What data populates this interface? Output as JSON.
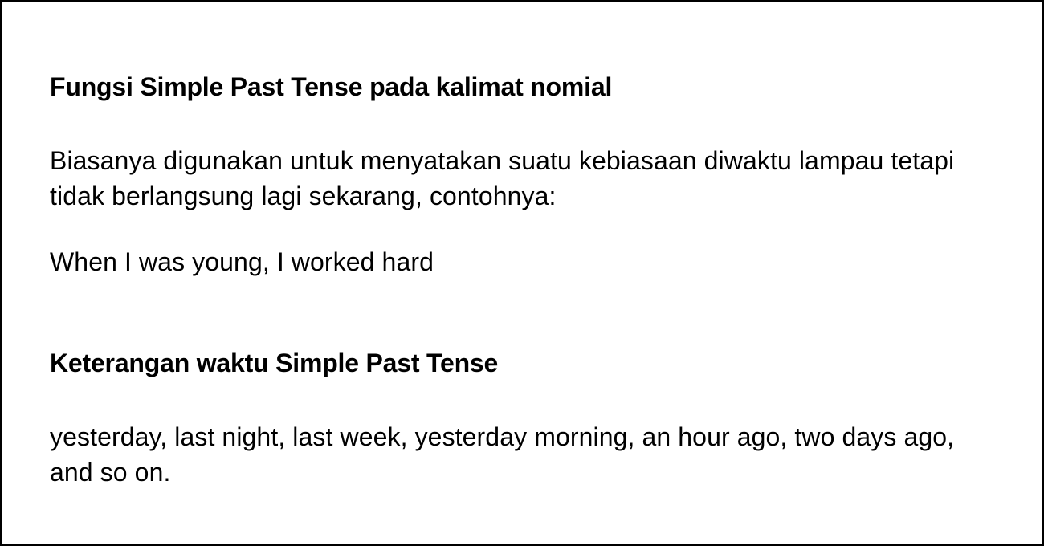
{
  "sections": [
    {
      "heading": "Fungsi Simple Past Tense pada kalimat nomial",
      "paragraphs": [
        "Biasanya digunakan untuk menyatakan suatu kebiasaan diwaktu lampau tetapi tidak berlangsung lagi sekarang, contohnya:",
        "When I was young, I worked hard"
      ]
    },
    {
      "heading": "Keterangan waktu Simple Past Tense",
      "paragraphs": [
        "yesterday, last night, last week, yesterday morning, an hour ago, two days ago, and so on."
      ]
    }
  ]
}
